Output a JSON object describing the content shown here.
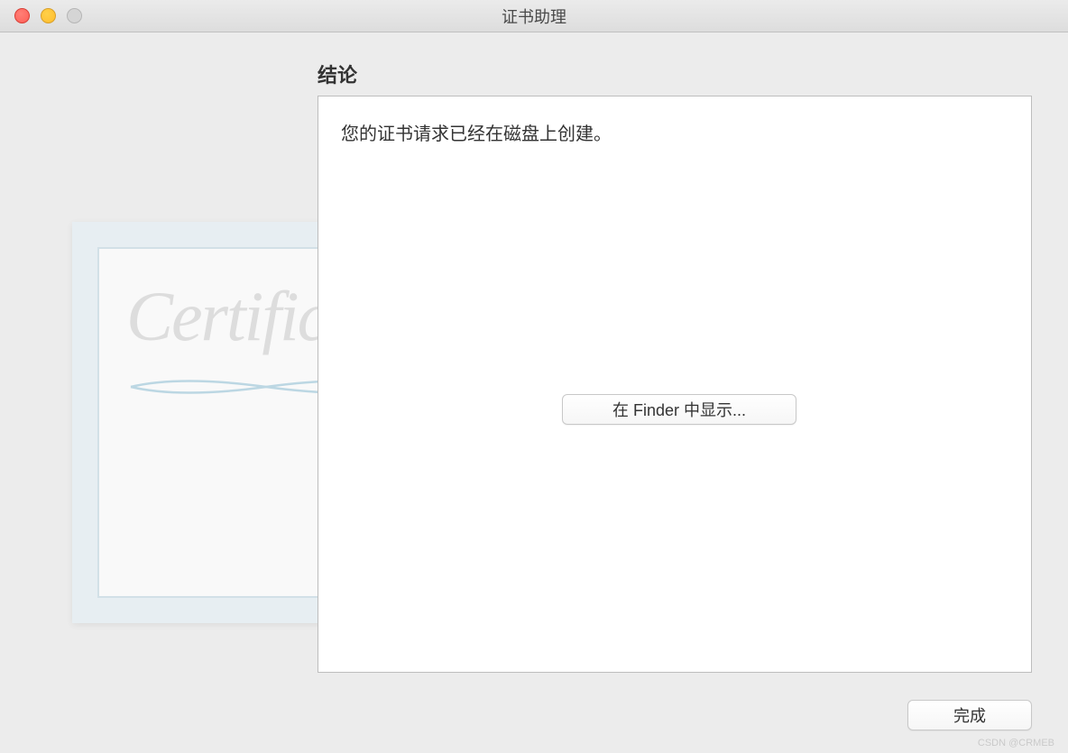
{
  "titlebar": {
    "title": "证书助理"
  },
  "heading": "结论",
  "message": "您的证书请求已经在磁盘上创建。",
  "buttons": {
    "show_in_finder": "在 Finder 中显示...",
    "done": "完成"
  },
  "certificate_graphic": {
    "script_text": "Certificate"
  },
  "watermark": "CSDN @CRMEB"
}
